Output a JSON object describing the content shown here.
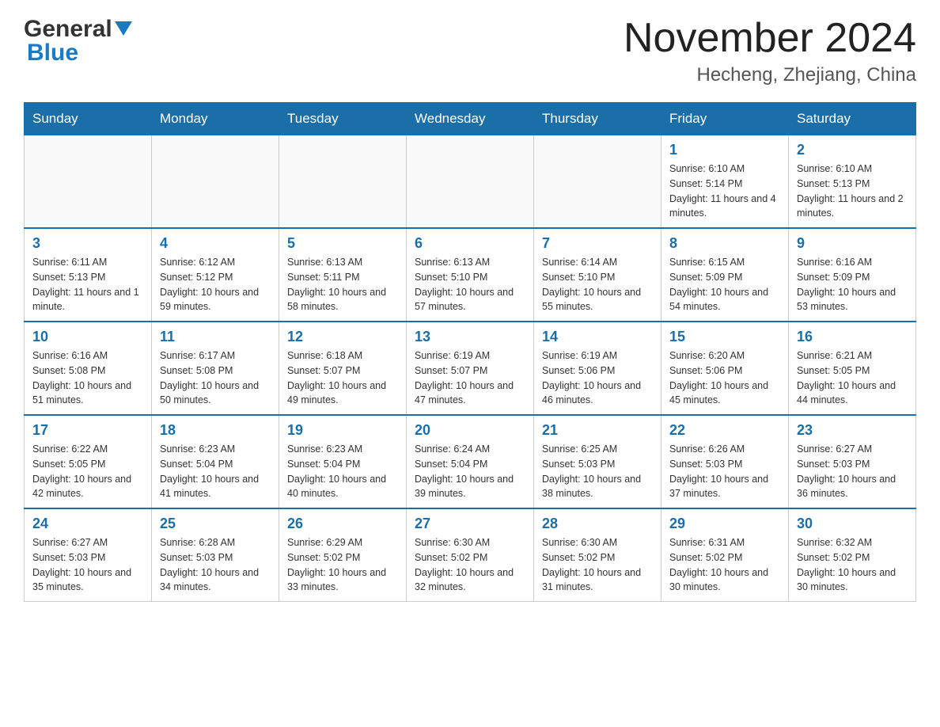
{
  "header": {
    "logo_general": "General",
    "logo_blue": "Blue",
    "month_year": "November 2024",
    "location": "Hecheng, Zhejiang, China"
  },
  "days_of_week": [
    "Sunday",
    "Monday",
    "Tuesday",
    "Wednesday",
    "Thursday",
    "Friday",
    "Saturday"
  ],
  "weeks": [
    {
      "days": [
        {
          "number": "",
          "sunrise": "",
          "sunset": "",
          "daylight": "",
          "empty": true
        },
        {
          "number": "",
          "sunrise": "",
          "sunset": "",
          "daylight": "",
          "empty": true
        },
        {
          "number": "",
          "sunrise": "",
          "sunset": "",
          "daylight": "",
          "empty": true
        },
        {
          "number": "",
          "sunrise": "",
          "sunset": "",
          "daylight": "",
          "empty": true
        },
        {
          "number": "",
          "sunrise": "",
          "sunset": "",
          "daylight": "",
          "empty": true
        },
        {
          "number": "1",
          "sunrise": "Sunrise: 6:10 AM",
          "sunset": "Sunset: 5:14 PM",
          "daylight": "Daylight: 11 hours and 4 minutes.",
          "empty": false
        },
        {
          "number": "2",
          "sunrise": "Sunrise: 6:10 AM",
          "sunset": "Sunset: 5:13 PM",
          "daylight": "Daylight: 11 hours and 2 minutes.",
          "empty": false
        }
      ]
    },
    {
      "days": [
        {
          "number": "3",
          "sunrise": "Sunrise: 6:11 AM",
          "sunset": "Sunset: 5:13 PM",
          "daylight": "Daylight: 11 hours and 1 minute.",
          "empty": false
        },
        {
          "number": "4",
          "sunrise": "Sunrise: 6:12 AM",
          "sunset": "Sunset: 5:12 PM",
          "daylight": "Daylight: 10 hours and 59 minutes.",
          "empty": false
        },
        {
          "number": "5",
          "sunrise": "Sunrise: 6:13 AM",
          "sunset": "Sunset: 5:11 PM",
          "daylight": "Daylight: 10 hours and 58 minutes.",
          "empty": false
        },
        {
          "number": "6",
          "sunrise": "Sunrise: 6:13 AM",
          "sunset": "Sunset: 5:10 PM",
          "daylight": "Daylight: 10 hours and 57 minutes.",
          "empty": false
        },
        {
          "number": "7",
          "sunrise": "Sunrise: 6:14 AM",
          "sunset": "Sunset: 5:10 PM",
          "daylight": "Daylight: 10 hours and 55 minutes.",
          "empty": false
        },
        {
          "number": "8",
          "sunrise": "Sunrise: 6:15 AM",
          "sunset": "Sunset: 5:09 PM",
          "daylight": "Daylight: 10 hours and 54 minutes.",
          "empty": false
        },
        {
          "number": "9",
          "sunrise": "Sunrise: 6:16 AM",
          "sunset": "Sunset: 5:09 PM",
          "daylight": "Daylight: 10 hours and 53 minutes.",
          "empty": false
        }
      ]
    },
    {
      "days": [
        {
          "number": "10",
          "sunrise": "Sunrise: 6:16 AM",
          "sunset": "Sunset: 5:08 PM",
          "daylight": "Daylight: 10 hours and 51 minutes.",
          "empty": false
        },
        {
          "number": "11",
          "sunrise": "Sunrise: 6:17 AM",
          "sunset": "Sunset: 5:08 PM",
          "daylight": "Daylight: 10 hours and 50 minutes.",
          "empty": false
        },
        {
          "number": "12",
          "sunrise": "Sunrise: 6:18 AM",
          "sunset": "Sunset: 5:07 PM",
          "daylight": "Daylight: 10 hours and 49 minutes.",
          "empty": false
        },
        {
          "number": "13",
          "sunrise": "Sunrise: 6:19 AM",
          "sunset": "Sunset: 5:07 PM",
          "daylight": "Daylight: 10 hours and 47 minutes.",
          "empty": false
        },
        {
          "number": "14",
          "sunrise": "Sunrise: 6:19 AM",
          "sunset": "Sunset: 5:06 PM",
          "daylight": "Daylight: 10 hours and 46 minutes.",
          "empty": false
        },
        {
          "number": "15",
          "sunrise": "Sunrise: 6:20 AM",
          "sunset": "Sunset: 5:06 PM",
          "daylight": "Daylight: 10 hours and 45 minutes.",
          "empty": false
        },
        {
          "number": "16",
          "sunrise": "Sunrise: 6:21 AM",
          "sunset": "Sunset: 5:05 PM",
          "daylight": "Daylight: 10 hours and 44 minutes.",
          "empty": false
        }
      ]
    },
    {
      "days": [
        {
          "number": "17",
          "sunrise": "Sunrise: 6:22 AM",
          "sunset": "Sunset: 5:05 PM",
          "daylight": "Daylight: 10 hours and 42 minutes.",
          "empty": false
        },
        {
          "number": "18",
          "sunrise": "Sunrise: 6:23 AM",
          "sunset": "Sunset: 5:04 PM",
          "daylight": "Daylight: 10 hours and 41 minutes.",
          "empty": false
        },
        {
          "number": "19",
          "sunrise": "Sunrise: 6:23 AM",
          "sunset": "Sunset: 5:04 PM",
          "daylight": "Daylight: 10 hours and 40 minutes.",
          "empty": false
        },
        {
          "number": "20",
          "sunrise": "Sunrise: 6:24 AM",
          "sunset": "Sunset: 5:04 PM",
          "daylight": "Daylight: 10 hours and 39 minutes.",
          "empty": false
        },
        {
          "number": "21",
          "sunrise": "Sunrise: 6:25 AM",
          "sunset": "Sunset: 5:03 PM",
          "daylight": "Daylight: 10 hours and 38 minutes.",
          "empty": false
        },
        {
          "number": "22",
          "sunrise": "Sunrise: 6:26 AM",
          "sunset": "Sunset: 5:03 PM",
          "daylight": "Daylight: 10 hours and 37 minutes.",
          "empty": false
        },
        {
          "number": "23",
          "sunrise": "Sunrise: 6:27 AM",
          "sunset": "Sunset: 5:03 PM",
          "daylight": "Daylight: 10 hours and 36 minutes.",
          "empty": false
        }
      ]
    },
    {
      "days": [
        {
          "number": "24",
          "sunrise": "Sunrise: 6:27 AM",
          "sunset": "Sunset: 5:03 PM",
          "daylight": "Daylight: 10 hours and 35 minutes.",
          "empty": false
        },
        {
          "number": "25",
          "sunrise": "Sunrise: 6:28 AM",
          "sunset": "Sunset: 5:03 PM",
          "daylight": "Daylight: 10 hours and 34 minutes.",
          "empty": false
        },
        {
          "number": "26",
          "sunrise": "Sunrise: 6:29 AM",
          "sunset": "Sunset: 5:02 PM",
          "daylight": "Daylight: 10 hours and 33 minutes.",
          "empty": false
        },
        {
          "number": "27",
          "sunrise": "Sunrise: 6:30 AM",
          "sunset": "Sunset: 5:02 PM",
          "daylight": "Daylight: 10 hours and 32 minutes.",
          "empty": false
        },
        {
          "number": "28",
          "sunrise": "Sunrise: 6:30 AM",
          "sunset": "Sunset: 5:02 PM",
          "daylight": "Daylight: 10 hours and 31 minutes.",
          "empty": false
        },
        {
          "number": "29",
          "sunrise": "Sunrise: 6:31 AM",
          "sunset": "Sunset: 5:02 PM",
          "daylight": "Daylight: 10 hours and 30 minutes.",
          "empty": false
        },
        {
          "number": "30",
          "sunrise": "Sunrise: 6:32 AM",
          "sunset": "Sunset: 5:02 PM",
          "daylight": "Daylight: 10 hours and 30 minutes.",
          "empty": false
        }
      ]
    }
  ]
}
